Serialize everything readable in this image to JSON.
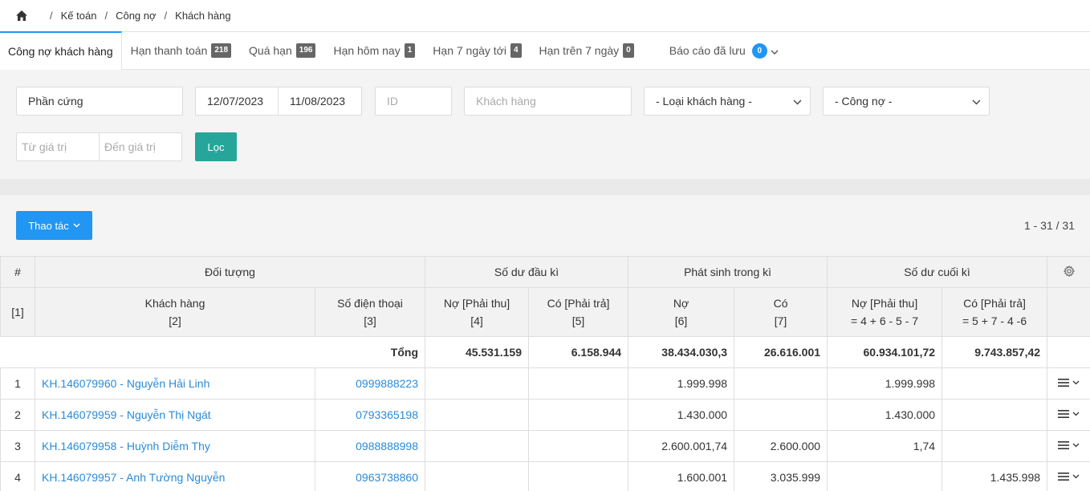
{
  "breadcrumb": {
    "items": [
      "Kế toán",
      "Công nợ",
      "Khách hàng"
    ]
  },
  "tabs": [
    {
      "label": "Công nợ khách hàng",
      "badge": ""
    },
    {
      "label": "Hạn thanh toán",
      "badge": "218"
    },
    {
      "label": "Quá hạn",
      "badge": "196"
    },
    {
      "label": "Hạn hôm nay",
      "badge": "1"
    },
    {
      "label": "Hạn 7 ngày tới",
      "badge": "4"
    },
    {
      "label": "Hạn trên 7 ngày",
      "badge": "0"
    },
    {
      "label": "Báo cáo đã lưu",
      "badge": "0"
    }
  ],
  "filters": {
    "store_value": "Phần cứng",
    "date_from": "12/07/2023",
    "date_to": "11/08/2023",
    "id_placeholder": "ID",
    "customer_placeholder": "Khách hàng",
    "customer_type": "- Loại khách hàng -",
    "debt_type": "- Công nợ -",
    "value_from_placeholder": "Từ giá trị",
    "value_to_placeholder": "Đến giá trị",
    "filter_button": "Lọc"
  },
  "actions": {
    "button": "Thao tác",
    "pager": "1 - 31 / 31"
  },
  "table": {
    "h1": {
      "index": "#",
      "object": "Đối tượng",
      "opening": "Số dư đầu kì",
      "period": "Phát sinh trong kì",
      "closing": "Số dư cuối kì"
    },
    "h2": {
      "index": "[1]",
      "customer": "Khách hàng",
      "customer_n": "[2]",
      "phone": "Số điện thoại",
      "phone_n": "[3]",
      "open_debit": "Nợ [Phải thu]",
      "open_debit_n": "[4]",
      "open_credit": "Có [Phải trả]",
      "open_credit_n": "[5]",
      "debit": "Nợ",
      "debit_n": "[6]",
      "credit": "Có",
      "credit_n": "[7]",
      "close_debit": "Nợ [Phải thu]",
      "close_debit_f": "= 4 + 6 - 5 - 7",
      "close_credit": "Có [Phải trả]",
      "close_credit_f": "= 5 + 7 - 4 -6"
    },
    "total": {
      "label": "Tổng",
      "open_debit": "45.531.159",
      "open_credit": "6.158.944",
      "debit": "38.434.030,3",
      "credit": "26.616.001",
      "close_debit": "60.934.101,72",
      "close_credit": "9.743.857,42"
    },
    "rows": [
      {
        "index": "1",
        "customer": "KH.146079960 - Nguyễn Hải Linh",
        "phone": "0999888223",
        "open_debit": "",
        "open_credit": "",
        "debit": "1.999.998",
        "credit": "",
        "close_debit": "1.999.998",
        "close_credit": ""
      },
      {
        "index": "2",
        "customer": "KH.146079959 - Nguyễn Thị Ngát",
        "phone": "0793365198",
        "open_debit": "",
        "open_credit": "",
        "debit": "1.430.000",
        "credit": "",
        "close_debit": "1.430.000",
        "close_credit": ""
      },
      {
        "index": "3",
        "customer": "KH.146079958 - Huỳnh Diễm Thy",
        "phone": "0988888998",
        "open_debit": "",
        "open_credit": "",
        "debit": "2.600.001,74",
        "credit": "2.600.000",
        "close_debit": "1,74",
        "close_credit": ""
      },
      {
        "index": "4",
        "customer": "KH.146079957 - Anh Tường Nguyễn",
        "phone": "0963738860",
        "open_debit": "",
        "open_credit": "",
        "debit": "1.600.001",
        "credit": "3.035.999",
        "close_debit": "",
        "close_credit": "1.435.998"
      }
    ]
  },
  "colors": {
    "primary": "#2196f3",
    "teal": "#26a69a",
    "link": "#2a8bd8"
  }
}
